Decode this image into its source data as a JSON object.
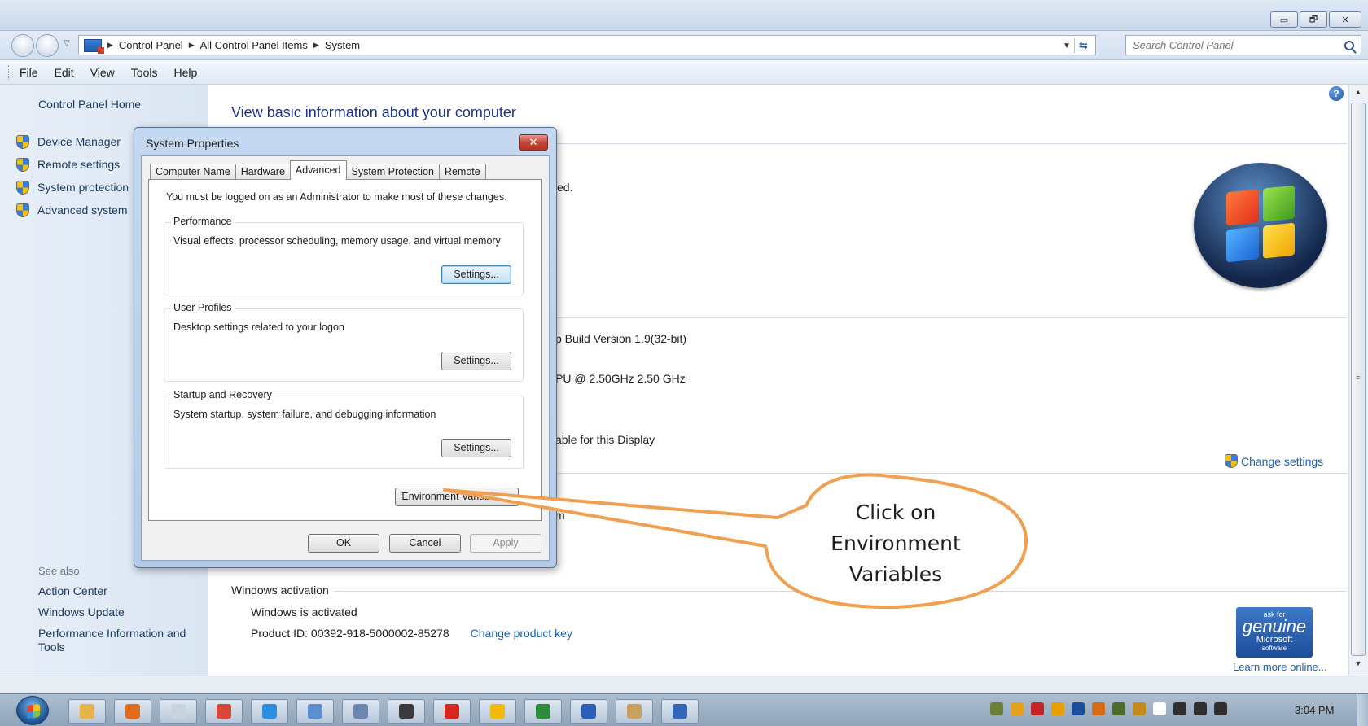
{
  "window": {
    "controls": [
      {
        "name": "minimize",
        "glyph": "▭"
      },
      {
        "name": "maximize",
        "glyph": "🗗"
      },
      {
        "name": "close",
        "glyph": "✕"
      }
    ]
  },
  "navigation": {
    "breadcrumbs": [
      "Control Panel",
      "All Control Panel Items",
      "System"
    ],
    "search_placeholder": "Search Control Panel"
  },
  "menu": [
    "File",
    "Edit",
    "View",
    "Tools",
    "Help"
  ],
  "left_panel": {
    "home": "Control Panel Home",
    "tasks": [
      {
        "label": "Device Manager",
        "icon": "shield-icon"
      },
      {
        "label": "Remote settings",
        "icon": "shield-icon"
      },
      {
        "label": "System protection",
        "icon": "shield-icon"
      },
      {
        "label": "Advanced system",
        "icon": "shield-icon"
      }
    ],
    "see_also_header": "See also",
    "see_also_links": [
      "Action Center",
      "Windows Update",
      "Performance Information and Tools"
    ]
  },
  "main": {
    "title": "View basic information about your computer",
    "fragments": {
      "edition_tail": "ed.",
      "build": "p Build Version 1.9(32-bit)",
      "processor": "PU @ 2.50GHz   2.50 GHz",
      "display": "able for this Display",
      "workgroup_tail": "m"
    },
    "change_settings": "Change settings",
    "activation_header": "Windows activation",
    "activation_status": "Windows is activated",
    "product_id": "Product ID: 00392-918-5000002-85278",
    "change_product_key": "Change product key",
    "genuine_badge": {
      "line1": "ask for",
      "line2": "genuine",
      "line3": "Microsoft",
      "line4": "software"
    },
    "learn_more": "Learn more online..."
  },
  "dialog": {
    "title": "System Properties",
    "tabs": [
      "Computer Name",
      "Hardware",
      "Advanced",
      "System Protection",
      "Remote"
    ],
    "active_tab": "Advanced",
    "admin_note": "You must be logged on as an Administrator to make most of these changes.",
    "groups": [
      {
        "label": "Performance",
        "description": "Visual effects, processor scheduling, memory usage, and virtual memory",
        "button": "Settings..."
      },
      {
        "label": "User Profiles",
        "description": "Desktop settings related to your logon",
        "button": "Settings..."
      },
      {
        "label": "Startup and Recovery",
        "description": "System startup, system failure, and debugging information",
        "button": "Settings..."
      }
    ],
    "env_button": "Environment Variables...",
    "ok": "OK",
    "cancel": "Cancel",
    "apply": "Apply"
  },
  "callout": {
    "lines": [
      "Click on",
      "Environment",
      "Variables"
    ],
    "stroke_color": "#f0a050"
  },
  "taskbar": {
    "clock": "3:04 PM",
    "app_icon_colors": [
      "#e8b34a",
      "#e36b1e",
      "#c9d3dd",
      "#d9463a",
      "#2e8fe0",
      "#5c8fd0",
      "#6b86b3",
      "#3a3a3a",
      "#d7261e",
      "#f0b90b",
      "#2f8a3c",
      "#2b5eb8",
      "#c8a060",
      "#3466b8"
    ],
    "tray_icon_colors": [
      "#6e7f3b",
      "#e3a21b",
      "#c62424",
      "#e8a000",
      "#1b4f9c",
      "#d86b16",
      "#4d6b2a",
      "#c28b1a",
      "#ffffff",
      "#2f2f2f",
      "#2f2f2f",
      "#2f2f2f"
    ]
  }
}
